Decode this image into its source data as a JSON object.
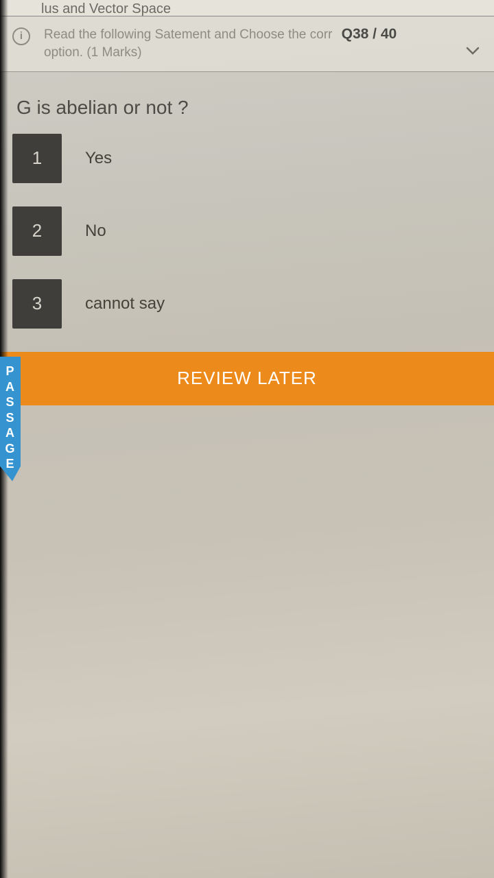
{
  "topbar": {
    "title": "lus and Vector Space"
  },
  "instruction": {
    "text_line1": "Read the following Satement and Choose the corr",
    "text_line2": "option. (1 Marks)",
    "qnum": "Q38 / 40"
  },
  "question": "G is abelian or not ?",
  "options": [
    {
      "num": "1",
      "label": "Yes"
    },
    {
      "num": "2",
      "label": "No"
    },
    {
      "num": "3",
      "label": "cannot say"
    }
  ],
  "side_tab": "PASSAGE",
  "review_button": "REVIEW LATER"
}
